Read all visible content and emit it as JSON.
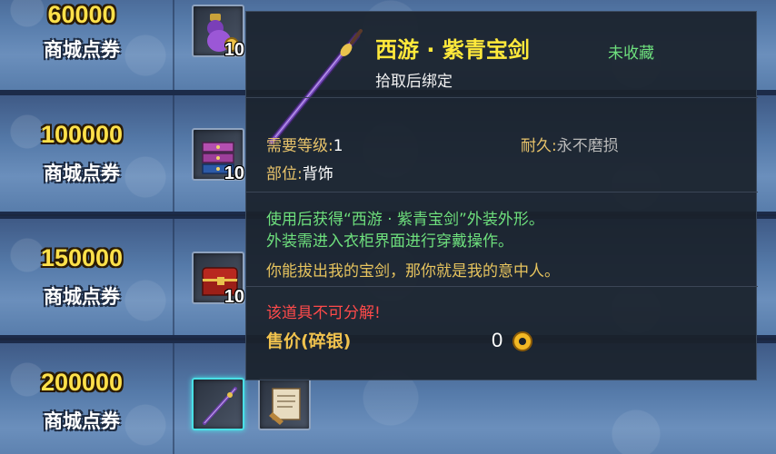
{
  "colors": {
    "amount": "#ffe14a",
    "item_name": "#ffe93b",
    "uncollected": "#6ee07d",
    "description": "#6ee07d",
    "flavor": "#e6c35e",
    "warning": "#ff4a4a",
    "selected_slot_border": "#49e0e6"
  },
  "rewards": [
    {
      "amount": "60000",
      "currency": "商城点券",
      "items": [
        {
          "icon": "gourd-icon",
          "count": "10"
        }
      ]
    },
    {
      "amount": "100000",
      "currency": "商城点券",
      "items": [
        {
          "icon": "treasure-drawer-icon",
          "count": "10"
        }
      ]
    },
    {
      "amount": "150000",
      "currency": "商城点券",
      "items": [
        {
          "icon": "red-chest-icon",
          "count": "10"
        }
      ]
    },
    {
      "amount": "200000",
      "currency": "商城点券",
      "items": [
        {
          "icon": "purple-sword-icon",
          "count": ""
        },
        {
          "icon": "scroll-icon",
          "count": ""
        }
      ]
    }
  ],
  "tooltip": {
    "item_icon": "purple-sword-icon",
    "name": "西游 · 紫青宝剑",
    "collection_status": "未收藏",
    "binding": "拾取后绑定",
    "level_label": "需要等级:",
    "level_value": "1",
    "durability_label": "耐久:",
    "durability_value": "永不磨损",
    "slot_label": "部位:",
    "slot_value": "背饰",
    "description_line1": "使用后获得“西游 · 紫青宝剑”外装外形。",
    "description_line2": "外装需进入衣柜界面进行穿戴操作。",
    "flavor_text": "你能拔出我的宝剑，那你就是我的意中人。",
    "warning": "该道具不可分解!",
    "price_label": "售价(碎银)",
    "price_value": "0",
    "price_icon": "silver-coin-icon"
  }
}
